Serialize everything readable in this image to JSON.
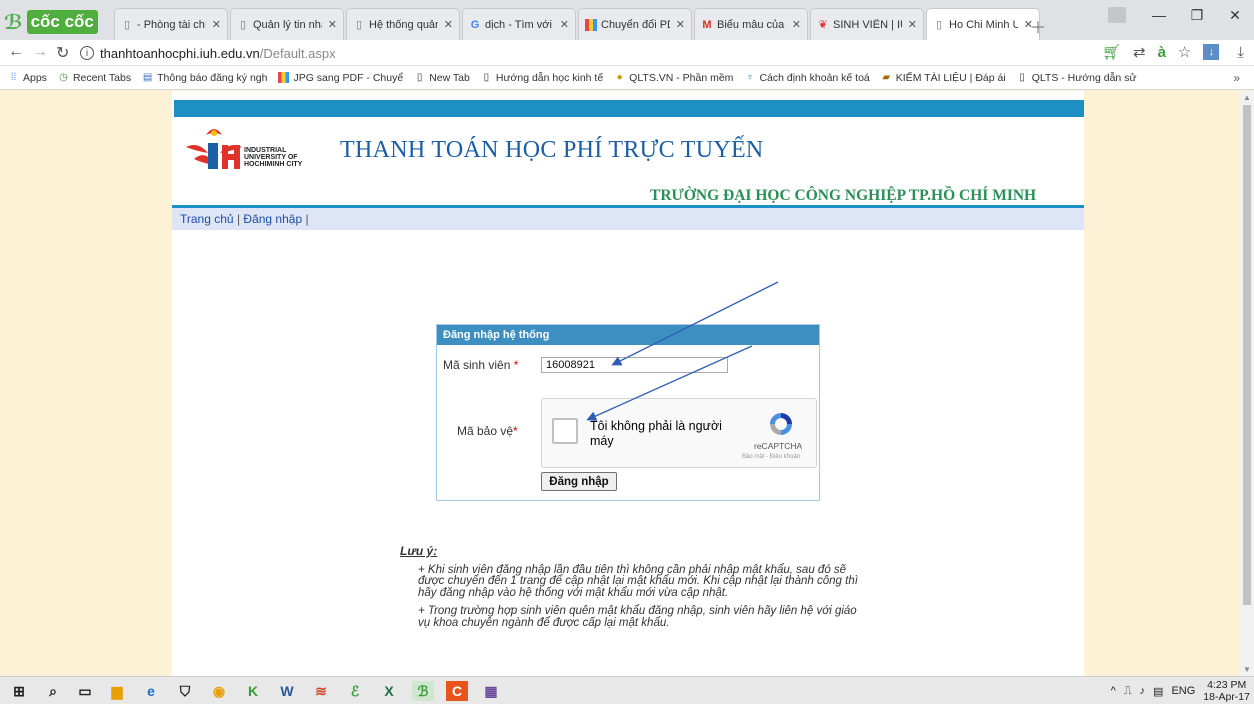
{
  "browser": {
    "brand": "cốc cốc",
    "tabs": [
      {
        "label": "- Phòng tài chín",
        "icon": "page-icon"
      },
      {
        "label": "Quản lý tin nhắ",
        "icon": "page-icon"
      },
      {
        "label": "Hệ thống quản",
        "icon": "page-icon"
      },
      {
        "label": "dịch - Tìm với C",
        "icon": "google-icon"
      },
      {
        "label": "Chuyển đổi PDF",
        "icon": "pdf-convert-icon"
      },
      {
        "label": "Biểu mẫu của b",
        "icon": "gmail-icon"
      },
      {
        "label": "SINH VIÊN | IUI",
        "icon": "iuh-icon"
      },
      {
        "label": "Ho Chi Minh Ur",
        "icon": "page-icon",
        "active": true
      }
    ],
    "address": {
      "domain": "thanhtoanhocphi.iuh.edu.vn",
      "path": "/Default.aspx"
    },
    "bookmarks": [
      {
        "label": "Apps",
        "icon": "apps-icon"
      },
      {
        "label": "Recent Tabs",
        "icon": "recent-tabs-icon"
      },
      {
        "label": "Thông báo đăng ký ngh",
        "icon": "notice-icon"
      },
      {
        "label": "JPG sang PDF - Chuyể",
        "icon": "pdf-convert-icon"
      },
      {
        "label": "New Tab",
        "icon": "page-icon"
      },
      {
        "label": "Hướng dẫn học kinh tế",
        "icon": "page-icon"
      },
      {
        "label": "QLTS.VN - Phần mềm",
        "icon": "qlts-icon"
      },
      {
        "label": "Cách định khoản kế toá",
        "icon": "accounting-icon"
      },
      {
        "label": "KIẾM TÀI LIỆU | Đáp ái",
        "icon": "books-icon"
      },
      {
        "label": "QLTS - Hướng dẫn sử",
        "icon": "page-icon"
      }
    ],
    "more_bookmarks": "»"
  },
  "site": {
    "logo_text": [
      "INDUSTRIAL",
      "UNIVERSITY OF",
      "HOCHIMINH CITY"
    ],
    "title": "THANH TOÁN HỌC PHÍ TRỰC TUYẾN",
    "subtitle": "TRƯỜNG ĐẠI HỌC CÔNG NGHIỆP TP.HỒ CHÍ MINH",
    "nav": {
      "home": "Trang chủ",
      "login": "Đăng nhập",
      "sep": "|"
    }
  },
  "login": {
    "header": "Đăng nhập hệ thống",
    "student_id_label": "Mã sinh viên",
    "student_id_value": "16008921",
    "required_mark": "*",
    "captcha_label": "Mã bảo vệ",
    "captcha_text": "Tôi không phải là người máy",
    "captcha_brand": "reCAPTCHA",
    "captcha_terms": "Bảo mật - Điều khoản",
    "submit_label": "Đăng nhập"
  },
  "notes": {
    "title": "Lưu ý:",
    "items": [
      "+ Khi sinh viên đăng nhập lần đầu tiên thì không cần phải nhập mật khẩu, sau đó sẽ được chuyển đến 1 trang để cập nhật lại mật khẩu mới. Khi cập nhật lại thành công thì hãy đăng nhập vào hệ thống với mật khẩu mới vừa cập nhật.",
      "+ Trong trường hợp sinh viên quên mật khẩu đăng nhập, sinh viên hãy liên hệ với giáo vụ khoa chuyên ngành để được cấp lại mật khẩu."
    ]
  },
  "taskbar": {
    "language": "ENG",
    "time": "4:23 PM",
    "date": "18-Apr-17"
  },
  "colors": {
    "page_background": "#fdf1d6",
    "header_bar": "#1d8fc2",
    "title_blue": "#1b5ea6",
    "subtitle_green": "#2b8f57",
    "annotation_arrow": "#2f5fb5"
  }
}
